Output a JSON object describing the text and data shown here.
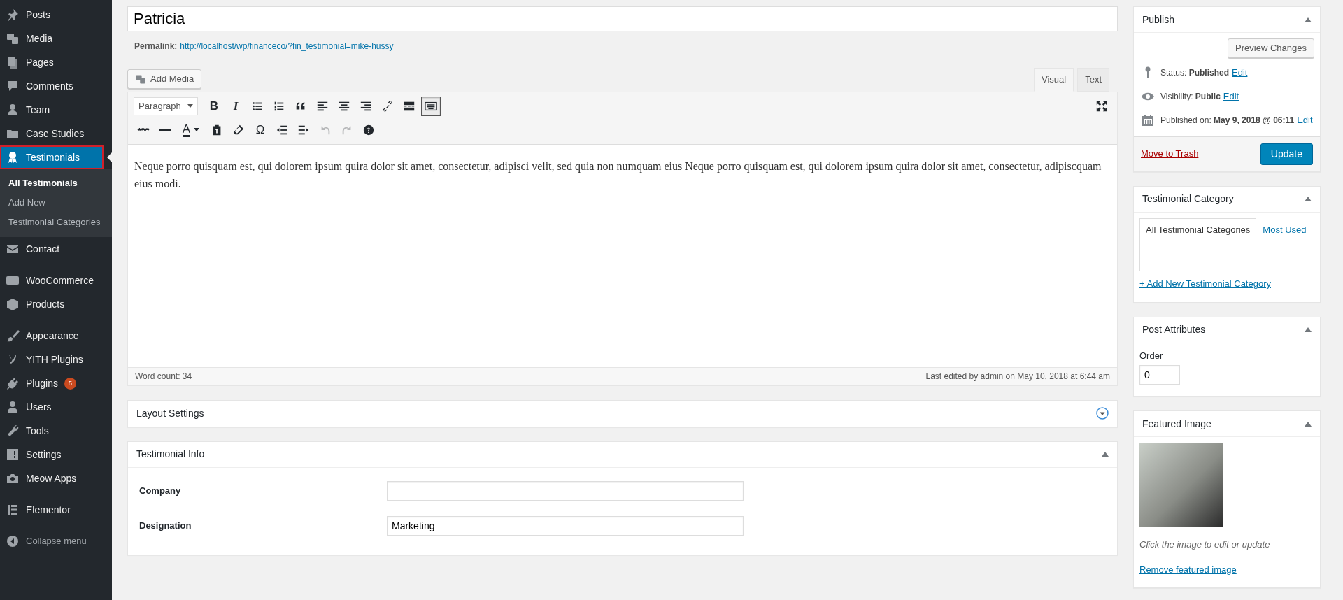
{
  "sidebar": {
    "groups": [
      [
        {
          "label": "Posts",
          "selected": false,
          "outlined": false
        },
        {
          "label": "Media",
          "selected": false,
          "outlined": false
        },
        {
          "label": "Pages",
          "selected": false,
          "outlined": false
        },
        {
          "label": "Comments",
          "selected": false,
          "outlined": false
        },
        {
          "label": "Team",
          "selected": false,
          "outlined": false
        },
        {
          "label": "Case Studies",
          "selected": false,
          "outlined": false
        },
        {
          "label": "Testimonials",
          "selected": true,
          "outlined": true,
          "children": [
            {
              "label": "All Testimonials",
              "selected": true
            },
            {
              "label": "Add New",
              "selected": false
            },
            {
              "label": "Testimonial Categories",
              "selected": false
            }
          ]
        },
        {
          "label": "Contact",
          "selected": false,
          "outlined": false
        }
      ],
      [
        {
          "label": "WooCommerce",
          "selected": false,
          "outlined": false
        },
        {
          "label": "Products",
          "selected": false,
          "outlined": false
        }
      ],
      [
        {
          "label": "Appearance",
          "selected": false,
          "outlined": false
        },
        {
          "label": "YITH Plugins",
          "selected": false,
          "outlined": false
        },
        {
          "label": "Plugins",
          "selected": false,
          "outlined": false,
          "badge": "5"
        },
        {
          "label": "Users",
          "selected": false,
          "outlined": false
        },
        {
          "label": "Tools",
          "selected": false,
          "outlined": false
        },
        {
          "label": "Settings",
          "selected": false,
          "outlined": false
        },
        {
          "label": "Meow Apps",
          "selected": false,
          "outlined": false
        }
      ],
      [
        {
          "label": "Elementor",
          "selected": false,
          "outlined": false
        }
      ]
    ],
    "collapse": "Collapse menu"
  },
  "post_title": "Patricia",
  "permalink": {
    "label": "Permalink:",
    "url": "http://localhost/wp/financeco/?fin_testimonial=mike-hussy"
  },
  "add_media": "Add Media",
  "editor_tabs": [
    {
      "label": "Visual",
      "selected": true
    },
    {
      "label": "Text",
      "selected": false
    }
  ],
  "toolbar": {
    "format": "Paragraph",
    "row_1": [
      {
        "label": "B",
        "pressed": false
      },
      {
        "label": "I",
        "pressed": false
      },
      {
        "pressed": false
      },
      {
        "pressed": false
      },
      {
        "pressed": false
      },
      {
        "pressed": false
      },
      {
        "pressed": false
      },
      {
        "pressed": false
      },
      {
        "pressed": false
      },
      {
        "pressed": false
      },
      {
        "pressed": true
      }
    ],
    "row_2": [
      {
        "label": "ABC",
        "disabled": false
      },
      {
        "disabled": false
      },
      {
        "label": "A",
        "disabled": false
      },
      {
        "disabled": false
      },
      {
        "disabled": false
      },
      {
        "label": "Ω",
        "disabled": false
      },
      {
        "disabled": false
      },
      {
        "disabled": false
      },
      {
        "disabled": true
      },
      {
        "disabled": true
      },
      {
        "disabled": false
      }
    ]
  },
  "content": "Neque porro quisquam est, qui dolorem ipsum quira dolor sit amet, consectetur, adipisci velit, sed quia non numquam eius Neque porro quisquam est, qui dolorem ipsum quira dolor sit amet, consectetur, adipiscquam eius modi.",
  "status": {
    "word_count": "Word count: 34",
    "last_edited": "Last edited by admin on May 10, 2018 at 6:44 am"
  },
  "main_boxes": [
    {
      "title": "Layout Settings",
      "expanded": false
    },
    {
      "title": "Testimonial Info",
      "expanded": true,
      "fields": [
        {
          "label": "Company"
        },
        {
          "label": "Designation",
          "value": "Marketing"
        }
      ]
    }
  ],
  "publish": {
    "title": "Publish",
    "expanded": true,
    "preview_button": "Preview Changes",
    "rows": [
      {
        "label": "Status:",
        "value": "Published",
        "link": "Edit"
      },
      {
        "label": "Visibility:",
        "value": "Public",
        "link": "Edit"
      },
      {
        "label": "Published on:",
        "value": "May 9, 2018 @ 06:11",
        "link": "Edit"
      }
    ],
    "trash_link": "Move to Trash",
    "update_button": "Update"
  },
  "category": {
    "title": "Testimonial Category",
    "expanded": true,
    "tabs": [
      {
        "label": "All Testimonial Categories",
        "selected": true
      },
      {
        "label": "Most Used",
        "selected": false
      }
    ],
    "add_link": "+ Add New Testimonial Category"
  },
  "attributes": {
    "title": "Post Attributes",
    "expanded": true,
    "order_label": "Order",
    "order_value": "0"
  },
  "featured": {
    "title": "Featured Image",
    "expanded": true,
    "caption": "Click the image to edit or update",
    "remove_link": "Remove featured image"
  }
}
